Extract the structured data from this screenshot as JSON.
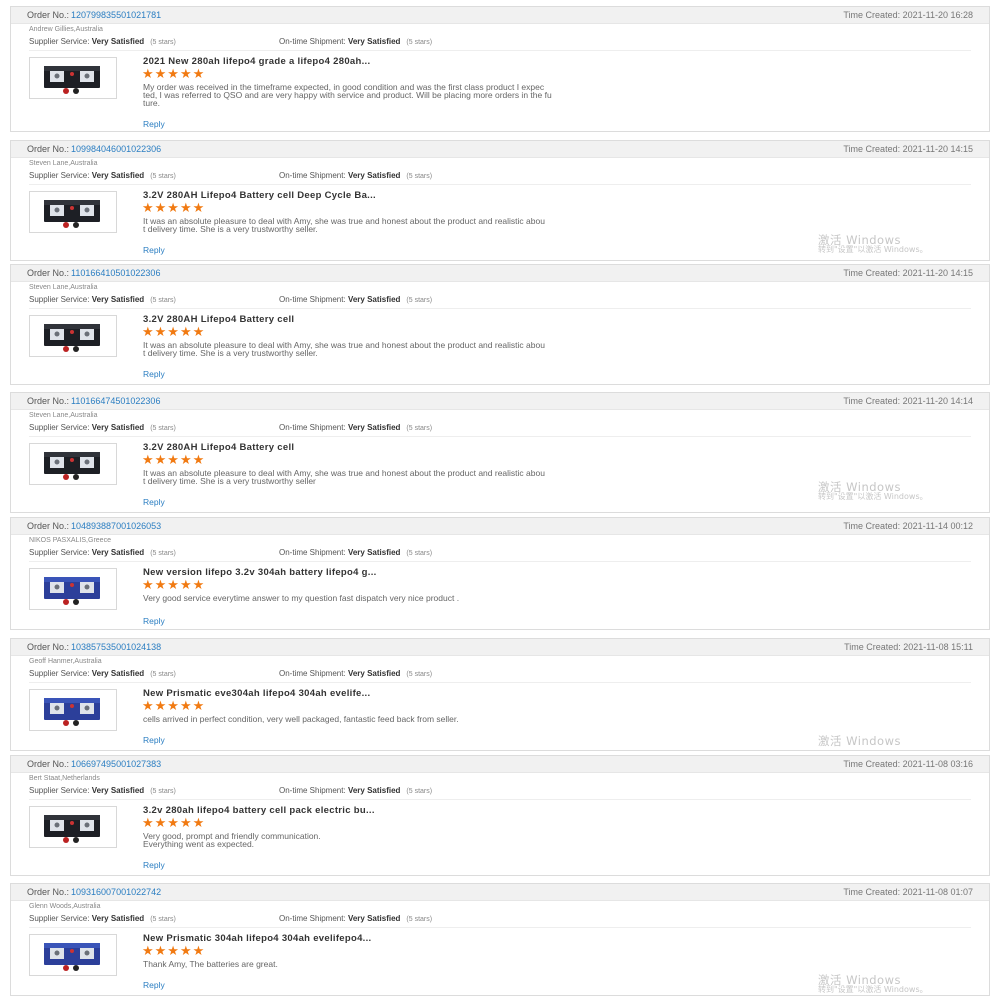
{
  "labels": {
    "order_no": "Order No.:",
    "time_created": "Time Created:",
    "supplier_service": "Supplier Service:",
    "on_time_shipment": "On-time Shipment:",
    "reply": "Reply"
  },
  "watermark": {
    "line1": "激活 Windows",
    "line2": "转到\"设置\"以激活 Windows。"
  },
  "reviews": [
    {
      "order_no": "12079983550102178​1",
      "time": "2021-11-20 16:28",
      "buyer": "Andrew Gillies,Australia",
      "supplier_value": "Very Satisfied",
      "supplier_stars": "(5 stars)",
      "shipment_value": "Very Satisfied",
      "shipment_stars": "(5 stars)",
      "product": "2021 New 280ah lifepo4 grade a lifepo4 280ah...",
      "stars": "★★★★★",
      "rating": 5,
      "review": "My order was received in the timeframe expected, in good condition and was the first class product I expec\nted, I was referred to QSO and are very happy with service and product. Will be placing more orders in the fu\nture.",
      "thumb": "battery-cell-black"
    },
    {
      "order_no": "109984046001022306",
      "time": "2021-11-20 14:15",
      "buyer": "Steven Lane,Australia",
      "supplier_value": "Very Satisfied",
      "supplier_stars": "(5 stars)",
      "shipment_value": "Very Satisfied",
      "shipment_stars": "(5 stars)",
      "product": "3.2V 280AH Lifepo4 Battery cell Deep Cycle Ba...",
      "stars": "★★★★★",
      "rating": 5,
      "review": "It was an absolute pleasure to deal with Amy, she was true and honest about the product and realistic abou\nt delivery time. She is a very trustworthy seller.",
      "thumb": "battery-cell-black"
    },
    {
      "order_no": "110166410501022306",
      "time": "2021-11-20 14:15",
      "buyer": "Steven Lane,Australia",
      "supplier_value": "Very Satisfied",
      "supplier_stars": "(5 stars)",
      "shipment_value": "Very Satisfied",
      "shipment_stars": "(5 stars)",
      "product": "3.2V 280AH Lifepo4 Battery cell",
      "stars": "★★★★★",
      "rating": 5,
      "review": "It was an absolute pleasure to deal with Amy, she was true and honest about the product and realistic abou\nt delivery time. She is a very trustworthy seller.",
      "thumb": "battery-cell-black"
    },
    {
      "order_no": "110166474501022306",
      "time": "2021-11-20 14:14",
      "buyer": "Steven Lane,Australia",
      "supplier_value": "Very Satisfied",
      "supplier_stars": "(5 stars)",
      "shipment_value": "Very Satisfied",
      "shipment_stars": "(5 stars)",
      "product": "3.2V 280AH Lifepo4 Battery cell",
      "stars": "★★★★★",
      "rating": 5,
      "review": "It was an absolute pleasure to deal with Amy, she was true and honest about the product and realistic abou\nt delivery time. She is a very trustworthy seller",
      "thumb": "battery-cell-black"
    },
    {
      "order_no": "104893887001026053",
      "time": "2021-11-14 00:12",
      "buyer": "NIKOS PASXALIS,Greece",
      "supplier_value": "Very Satisfied",
      "supplier_stars": "(5 stars)",
      "shipment_value": "Very Satisfied",
      "shipment_stars": "(5 stars)",
      "product": "New version lifepo 3.2v 304ah battery lifepo4 g...",
      "stars": "★★★★★",
      "rating": 5,
      "review": "Very good service everytime answer to my question fast dispatch very nice product .",
      "thumb": "battery-cell-blue"
    },
    {
      "order_no": "103857535001024138",
      "time": "2021-11-08 15:11",
      "buyer": "Geoff Hanmer,Australia",
      "supplier_value": "Very Satisfied",
      "supplier_stars": "(5 stars)",
      "shipment_value": "Very Satisfied",
      "shipment_stars": "(5 stars)",
      "product": "New Prismatic eve304ah lifepo4 304ah evelife...",
      "stars": "★★★★★",
      "rating": 5,
      "review": "cells arrived in perfect condition, very well packaged, fantastic feed back from seller.",
      "thumb": "battery-cell-blue"
    },
    {
      "order_no": "106697495001027383",
      "time": "2021-11-08 03:16",
      "buyer": "Bert Staat,Netherlands",
      "supplier_value": "Very Satisfied",
      "supplier_stars": "(5 stars)",
      "shipment_value": "Very Satisfied",
      "shipment_stars": "(5 stars)",
      "product": "3.2v 280ah lifepo4 battery cell pack electric bu...",
      "stars": "★★★★★",
      "rating": 5,
      "review": "Very good, prompt and friendly communication.\nEverything went as expected.",
      "thumb": "battery-cell-black"
    },
    {
      "order_no": "109316007001022742",
      "time": "2021-11-08 01:07",
      "buyer": "Glenn Woods,Australia",
      "supplier_value": "Very Satisfied",
      "supplier_stars": "(5 stars)",
      "shipment_value": "Very Satisfied",
      "shipment_stars": "(5 stars)",
      "product": "New Prismatic 304ah lifepo4 304ah evelifepo4...",
      "stars": "★★★★★",
      "rating": 5,
      "review": "Thank Amy, The batteries are great.",
      "thumb": "battery-cell-blue"
    }
  ]
}
